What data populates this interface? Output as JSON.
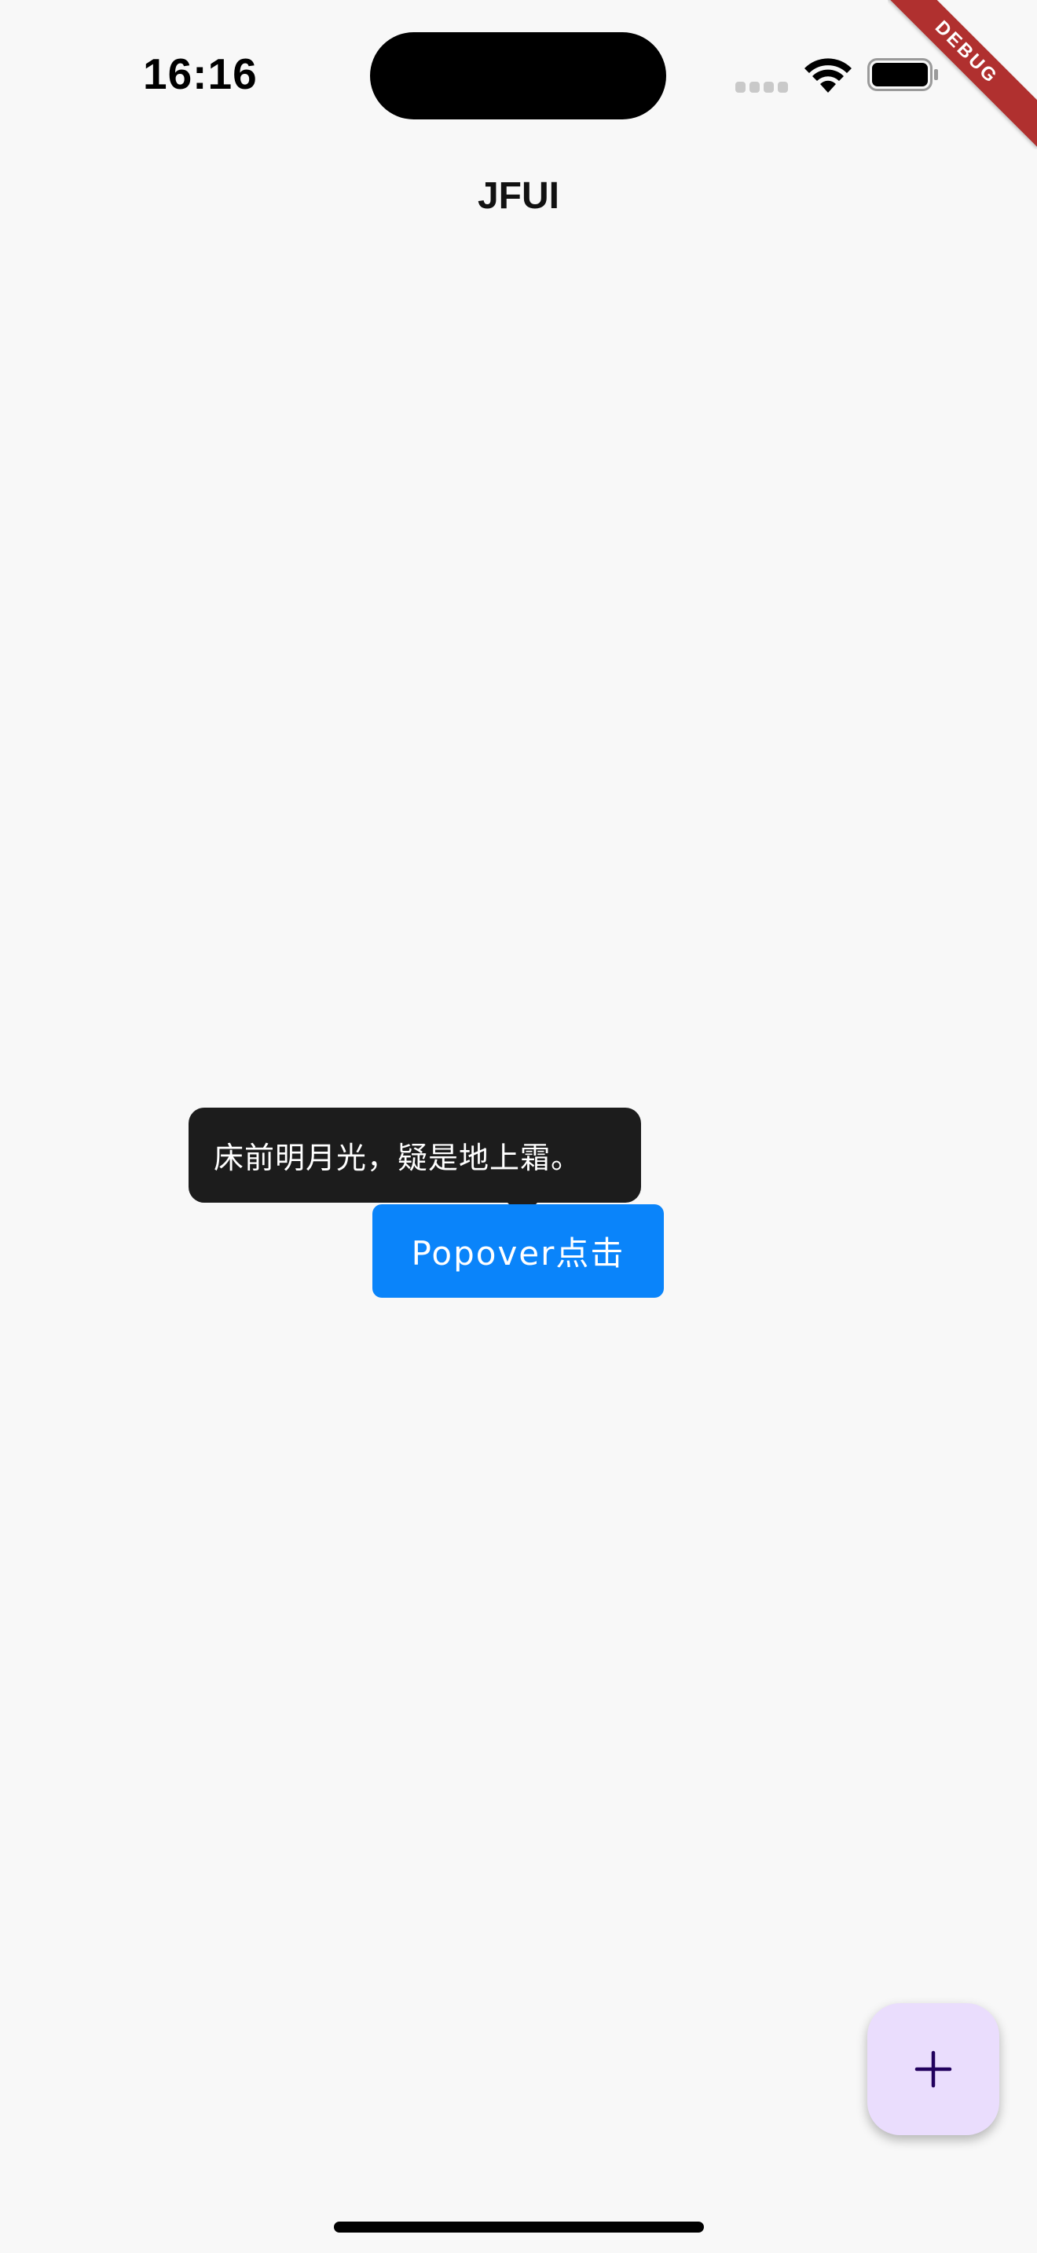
{
  "status_bar": {
    "time": "16:16",
    "icons": [
      "signal-icon",
      "wifi-icon",
      "battery-icon"
    ]
  },
  "debug_banner": "DEBUG",
  "app_bar": {
    "title": "JFUI"
  },
  "popover": {
    "text": "床前明月光，疑是地上霜。"
  },
  "main": {
    "popover_button_label": "Popover点击"
  },
  "fab": {
    "icon": "plus-icon"
  },
  "colors": {
    "background": "#f8f8f8",
    "popover_bg": "#1c1c1c",
    "button_bg": "#0a84fa",
    "fab_bg": "#eaddfd",
    "debug_ribbon": "#b0302f"
  }
}
